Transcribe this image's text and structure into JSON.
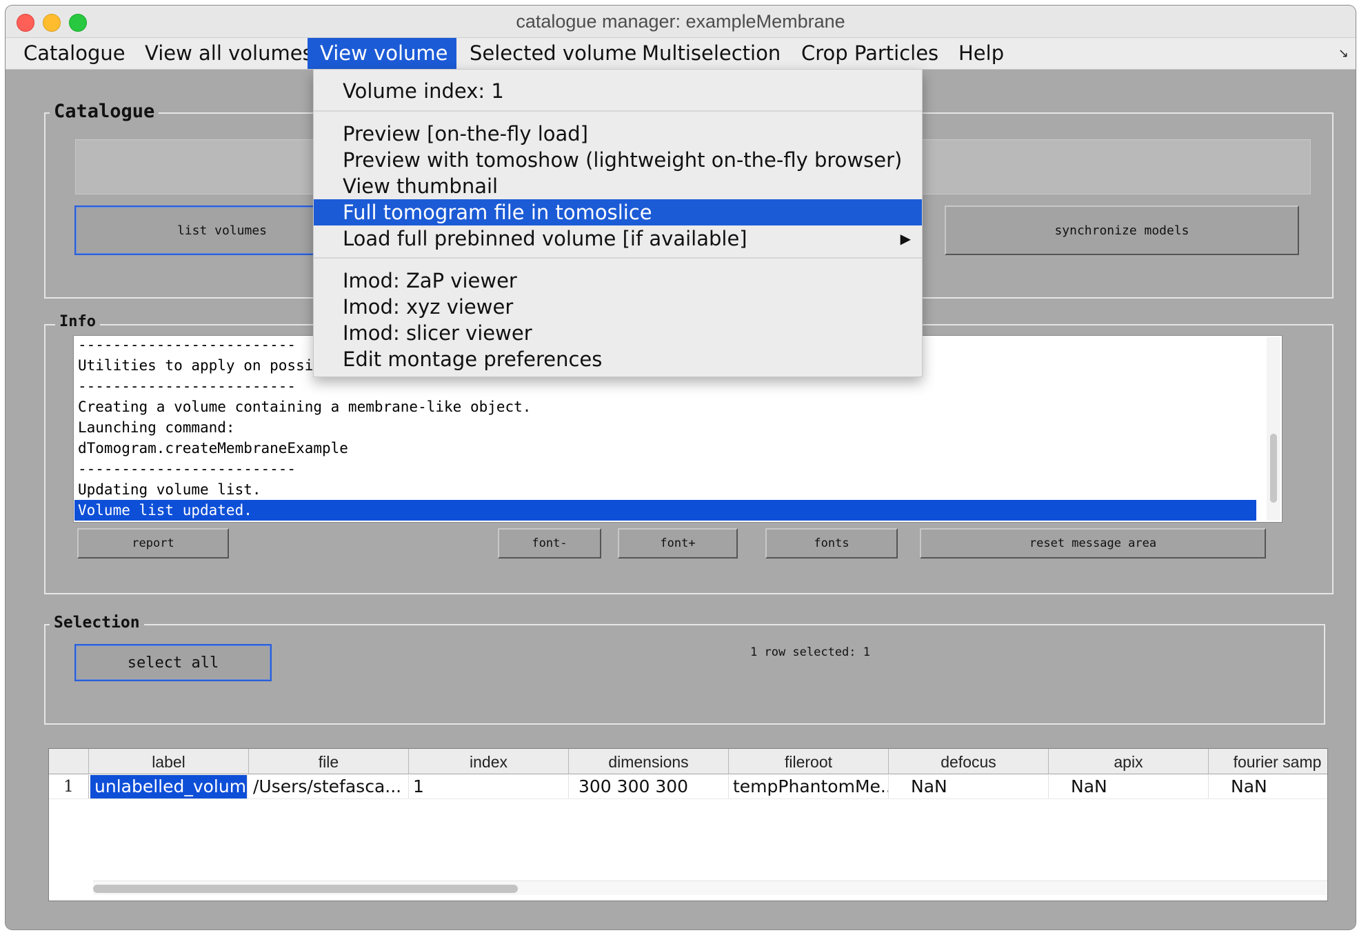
{
  "window": {
    "title": "catalogue manager: exampleMembrane"
  },
  "menubar": {
    "items": [
      "Catalogue",
      "View all volumes",
      "View volume",
      "Selected volume",
      "Multiselection",
      "Crop Particles",
      "Help"
    ],
    "active": "View volume"
  },
  "dropdown": {
    "header": "Volume index: 1",
    "group1": [
      "Preview [on-the-fly load]",
      "Preview with tomoshow (lightweight on-the-fly browser)",
      "View thumbnail",
      "Full tomogram file in tomoslice",
      "Load full prebinned volume [if available]"
    ],
    "highlighted": "Full tomogram file in tomoslice",
    "submenu_arrow": "▶",
    "group2": [
      "Imod: ZaP viewer",
      "Imod: xyz viewer",
      "Imod: slicer viewer",
      "Edit montage preferences"
    ]
  },
  "catalogue_panel": {
    "title": "Catalogue",
    "list_volumes_label": "list volumes",
    "synchronize_label": "synchronize models"
  },
  "info_panel": {
    "title": "Info",
    "lines": [
      "-------------------------",
      "Utilities to apply on possibly se",
      "-------------------------",
      "Creating a volume containing a membrane-like object.",
      "Launching command:",
      "dTomogram.createMembraneExample",
      "-------------------------",
      "Updating volume list.",
      "Volume list updated."
    ],
    "buttons": {
      "report": "report",
      "font_minus": "font-",
      "font_plus": "font+",
      "fonts": "fonts",
      "reset": "reset message area"
    }
  },
  "selection_panel": {
    "title": "Selection",
    "select_all_label": "select all",
    "status": "1 row selected: 1"
  },
  "table": {
    "columns": [
      "label",
      "file",
      "index",
      "dimensions",
      "fileroot",
      "defocus",
      "apix",
      "fourier samp"
    ],
    "rows": [
      {
        "num": "1",
        "cells": [
          "unlabelled_volume",
          "/Users/stefasca...",
          "1",
          "300 300 300",
          "tempPhantomMe...",
          "NaN",
          "NaN",
          "NaN"
        ]
      }
    ]
  }
}
